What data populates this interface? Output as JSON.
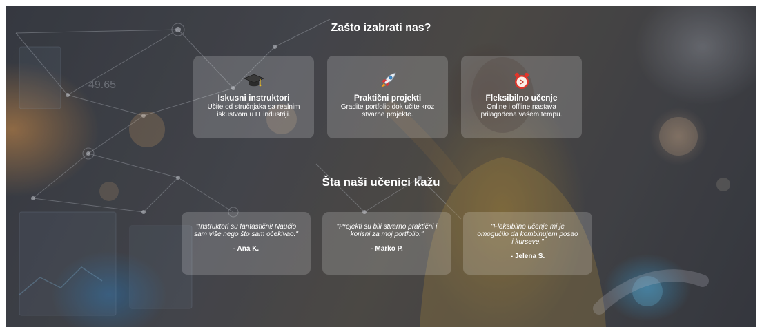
{
  "why": {
    "title": "Zašto izabrati nas?",
    "cards": [
      {
        "icon": "graduation-cap-icon",
        "title": "Iskusni instruktori",
        "text": "Učite od stručnjaka sa realnim iskustvom u IT industriji."
      },
      {
        "icon": "rocket-icon",
        "title": "Praktični projekti",
        "text": "Gradite portfolio dok učite kroz stvarne projekte."
      },
      {
        "icon": "alarm-clock-icon",
        "title": "Fleksibilno učenje",
        "text": "Online i offline nastava prilagođena vašem tempu."
      }
    ]
  },
  "testimonials": {
    "title": "Šta naši učenici kažu",
    "items": [
      {
        "quote": "\"Instruktori su fantastični! Naučio sam više nego što sam očekivao.\"",
        "author": "- Ana K."
      },
      {
        "quote": "\"Projekti su bili stvarno praktični i korisni za moj portfolio.\"",
        "author": "- Marko P."
      },
      {
        "quote": "\"Fleksibilno učenje mi je omogućilo da kombinujem posao i kurseve.\"",
        "author": "- Jelena S."
      }
    ]
  },
  "background": {
    "decor_text": "49.65"
  },
  "colors": {
    "text": "#ffffff",
    "card_bg": "rgba(255,255,255,0.18)",
    "alarm_red": "#e0352b",
    "rocket_flame": "#f39a1e"
  }
}
